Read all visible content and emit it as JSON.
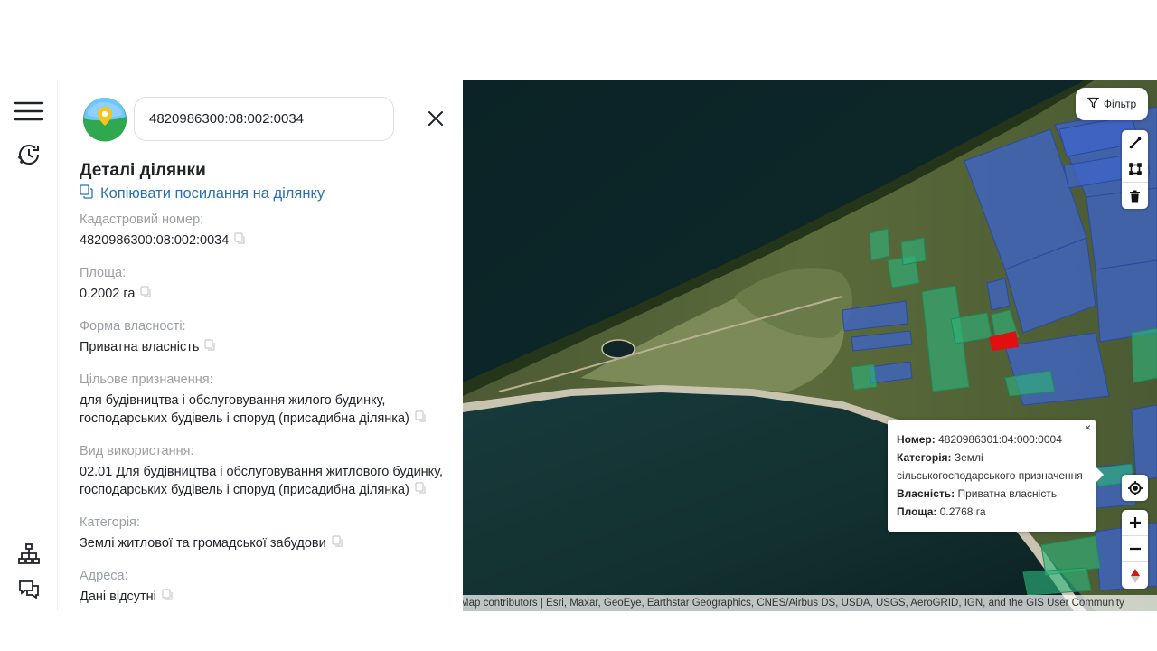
{
  "search": {
    "value": "4820986300:08:002:0034"
  },
  "details": {
    "title": "Деталі ділянки",
    "copy_link": "Копіювати посилання на ділянку",
    "fields": [
      {
        "label": "Кадастровий номер:",
        "value": "4820986300:08:002:0034"
      },
      {
        "label": "Площа:",
        "value": "0.2002 га"
      },
      {
        "label": "Форма власності:",
        "value": "Приватна власність"
      },
      {
        "label": "Цільове призначення:",
        "value": "для будівництва і обслуговування жилого будинку, господарських будівель і споруд (присадибна ділянка)"
      },
      {
        "label": "Вид використання:",
        "value": "02.01 Для будівництва і обслуговування житлового будинку, господарських будівель і споруд (присадибна ділянка)"
      },
      {
        "label": "Категорія:",
        "value": "Землі житлової та громадської забудови"
      },
      {
        "label": "Адреса:",
        "value": "Дані відсутні"
      }
    ]
  },
  "map": {
    "filter_label": "Фільтр",
    "attribution": "Map contributors | Esri, Maxar, GeoEye, Earthstar Geographics, CNES/Airbus DS, USDA, USGS, AeroGRID, IGN, and the GIS User Community",
    "popup": {
      "close": "×",
      "number_label": "Номер:",
      "number": "4820986301:04:000:0004",
      "category_label": "Категорія:",
      "category": "Землі сільськогосподарського призначення",
      "ownership_label": "Власність:",
      "ownership": "Приватна власність",
      "area_label": "Площа:",
      "area": "0.2768 га"
    }
  },
  "icons": {
    "menu": "menu-icon",
    "history": "history-icon",
    "sitemap": "sitemap-icon",
    "chat": "chat-icon",
    "close": "close-icon",
    "copy": "copy-icon",
    "filter": "filter-icon",
    "ruler": "ruler-icon",
    "polygon": "polygon-icon",
    "trash": "trash-icon",
    "locate": "locate-icon",
    "zoom_in": "zoom-in-icon",
    "zoom_out": "zoom-out-icon",
    "compass": "compass-icon"
  },
  "colors": {
    "link": "#2a6fb0",
    "selected_parcel": "#e01010",
    "parcel_blue": "#3f64c8",
    "parcel_green": "#2fb57a"
  }
}
